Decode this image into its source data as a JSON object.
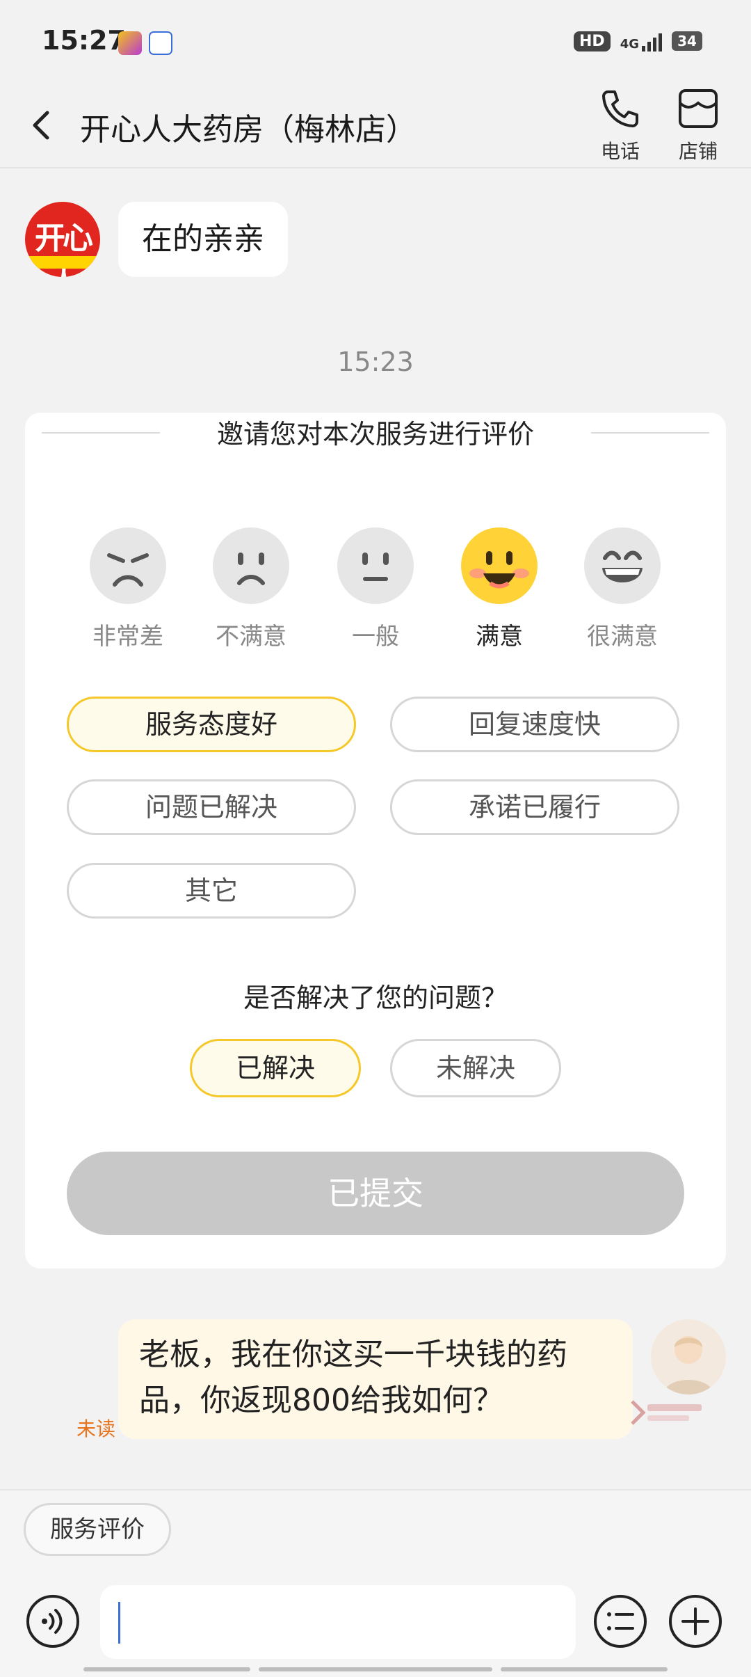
{
  "status_bar": {
    "time": "15:27",
    "hd": "HD",
    "network": "4G",
    "battery": "34"
  },
  "header": {
    "title": "开心人大药房（梅林店）",
    "phone_label": "电话",
    "shop_label": "店铺"
  },
  "store_message": {
    "avatar_text": "开心人",
    "text": "在的亲亲"
  },
  "timestamp": "15:23",
  "rating_card": {
    "title": "邀请您对本次服务进行评价",
    "levels": [
      {
        "label": "非常差",
        "selected": false
      },
      {
        "label": "不满意",
        "selected": false
      },
      {
        "label": "一般",
        "selected": false
      },
      {
        "label": "满意",
        "selected": true
      },
      {
        "label": "很满意",
        "selected": false
      }
    ],
    "tags": [
      {
        "label": "服务态度好",
        "selected": true
      },
      {
        "label": "回复速度快",
        "selected": false
      },
      {
        "label": "问题已解决",
        "selected": false
      },
      {
        "label": "承诺已履行",
        "selected": false
      },
      {
        "label": "其它",
        "selected": false
      }
    ],
    "question": "是否解决了您的问题？",
    "resolved_options": [
      {
        "label": "已解决",
        "selected": true
      },
      {
        "label": "未解决",
        "selected": false
      }
    ],
    "submit_label": "已提交"
  },
  "user_message": {
    "text": "老板，我在你这买一千块钱的药品，你返现800给我如何？",
    "status": "未读"
  },
  "bottom_bar": {
    "service_rating_label": "服务评价",
    "input_value": "",
    "input_placeholder": ""
  },
  "colors": {
    "accent": "#f5c829",
    "unread": "#e8731a",
    "submitted": "#c8c8c8"
  }
}
